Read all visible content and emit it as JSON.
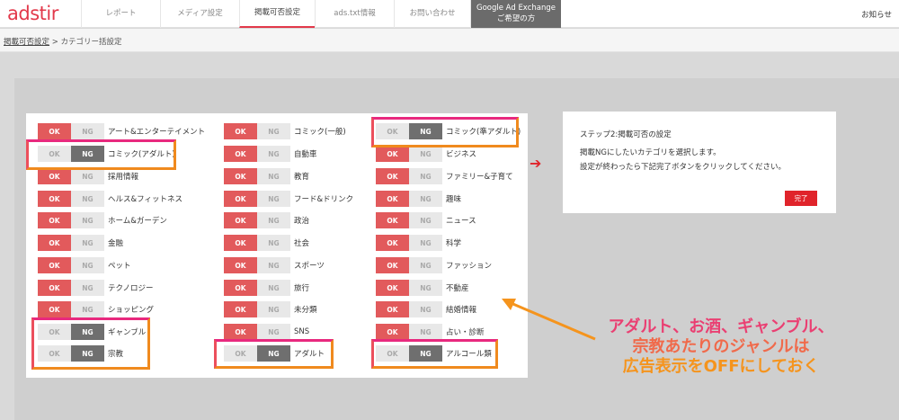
{
  "header": {
    "logo": "adstir",
    "tabs": [
      {
        "label": "レポート"
      },
      {
        "label": "メディア設定"
      },
      {
        "label": "掲載可否設定"
      },
      {
        "label": "ads.txt情報"
      },
      {
        "label": "お問い合わせ"
      },
      {
        "label": "Google Ad Exchangeご希望の方"
      }
    ],
    "notice": "お知らせ"
  },
  "breadcrumb": {
    "root": "掲載可否設定",
    "separator": ">",
    "current": "カテゴリー括設定"
  },
  "toggle": {
    "ok": "OK",
    "ng": "NG"
  },
  "categories": [
    {
      "label": "アート&エンターテイメント",
      "state": "OK"
    },
    {
      "label": "コミック(アダルト)",
      "state": "NG"
    },
    {
      "label": "採用情報",
      "state": "OK"
    },
    {
      "label": "ヘルス&フィットネス",
      "state": "OK"
    },
    {
      "label": "ホーム&ガーデン",
      "state": "OK"
    },
    {
      "label": "金融",
      "state": "OK"
    },
    {
      "label": "ペット",
      "state": "OK"
    },
    {
      "label": "テクノロジー",
      "state": "OK"
    },
    {
      "label": "ショッピング",
      "state": "OK"
    },
    {
      "label": "ギャンブル",
      "state": "NG"
    },
    {
      "label": "宗教",
      "state": "NG"
    },
    {
      "label": "コミック(一般)",
      "state": "OK"
    },
    {
      "label": "自動車",
      "state": "OK"
    },
    {
      "label": "教育",
      "state": "OK"
    },
    {
      "label": "フード&ドリンク",
      "state": "OK"
    },
    {
      "label": "政治",
      "state": "OK"
    },
    {
      "label": "社会",
      "state": "OK"
    },
    {
      "label": "スポーツ",
      "state": "OK"
    },
    {
      "label": "旅行",
      "state": "OK"
    },
    {
      "label": "未分類",
      "state": "OK"
    },
    {
      "label": "SNS",
      "state": "OK"
    },
    {
      "label": "アダルト",
      "state": "NG"
    },
    {
      "label": "コミック(準アダルト)",
      "state": "NG"
    },
    {
      "label": "ビジネス",
      "state": "OK"
    },
    {
      "label": "ファミリー&子育て",
      "state": "OK"
    },
    {
      "label": "趣味",
      "state": "OK"
    },
    {
      "label": "ニュース",
      "state": "OK"
    },
    {
      "label": "科学",
      "state": "OK"
    },
    {
      "label": "ファッション",
      "state": "OK"
    },
    {
      "label": "不動産",
      "state": "OK"
    },
    {
      "label": "結婚情報",
      "state": "OK"
    },
    {
      "label": "占い・診断",
      "state": "OK"
    },
    {
      "label": "アルコール類",
      "state": "NG"
    }
  ],
  "step": {
    "title": "ステップ2:掲載可否の設定",
    "lines": [
      "掲載NGにしたいカテゴリを選択します。",
      "設定が終わったら下記完了ボタンをクリックしてください。"
    ],
    "done": "完了"
  },
  "annotation": {
    "lines": [
      "アダルト、お酒、ギャンブル、",
      "宗教あたりのジャンルは",
      "広告表示をOFFにしておく"
    ]
  },
  "colors": {
    "accent": "#e2384a",
    "ok": "#e25a5c",
    "ng_active": "#6f6f6f",
    "highlight_top": "#e8297e",
    "highlight_bottom": "#f08a1e"
  }
}
